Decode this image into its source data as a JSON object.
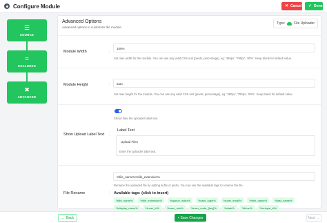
{
  "header": {
    "title": "Configure Module",
    "cancel_label": "Cancel",
    "done_label": "Done",
    "icon": "gear-icon"
  },
  "steps": [
    {
      "label": "SOURCE",
      "icon": "database-icon"
    },
    {
      "label": "EXCLUDES",
      "icon": "code-icon"
    },
    {
      "label": "ADVANCED",
      "icon": "tools-icon"
    }
  ],
  "panel": {
    "title": "Advanced Options",
    "subtitle": "Advanced options to customize the module.",
    "type_label": "Type:",
    "type_value": "File Uploader"
  },
  "fields": {
    "width": {
      "label": "Module Width",
      "value": "100%",
      "hint": "Set max width for the module. You can use any valid CSS unit (pixels, percentage), eg: '360px', '780px', '80%'. Keep blank for default value."
    },
    "height": {
      "label": "Module Height",
      "value": "auto",
      "hint": "Set max height for the module. You can use any valid CSS unit (pixels, percentage), eg: '360px', '780px', '80%'. Keep blank for default value."
    },
    "upload_label": {
      "label": "Show Upload Label Text",
      "toggle_hint": "Show/ hide the uploader label text.",
      "sub_label": "Label Text",
      "value": "Upload Files",
      "hint": "Enter the uploader label text."
    },
    "rename": {
      "label": "File Rename",
      "value": "%file_name%%file_extension%",
      "hint": "Rename the uploaded file by adding suffix or prefix. You can use the available tags to rename the file.",
      "tags_title": "Available tags: (click to insert)",
      "tags": [
        "%file_name%",
        "%file_extension%",
        "%queue_index%",
        "%user_login%",
        "%user_email%",
        "%first_name%",
        "%last_name%",
        "%display_name%",
        "%user_id%",
        "%user_role%",
        "%user_meta_{key}%",
        "%date%",
        "%time%",
        "%unique_id%"
      ]
    }
  },
  "footer": {
    "back_label": "Back",
    "save_label": "Save Changes",
    "next_label": "Next"
  },
  "colors": {
    "accent": "#22c55e",
    "cancel": "#ef4444",
    "toggle": "#2563eb"
  }
}
